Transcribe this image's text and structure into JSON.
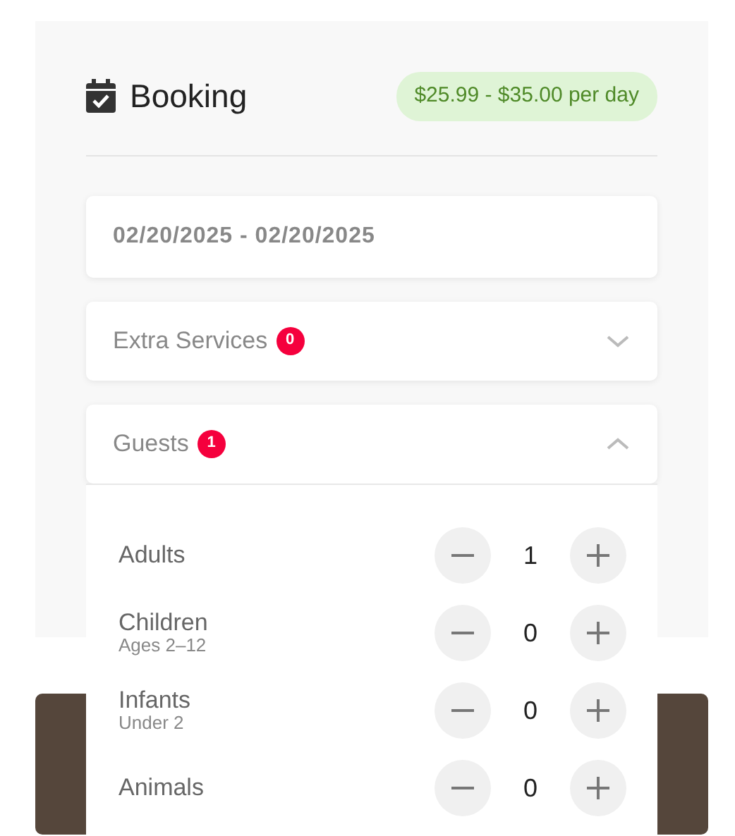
{
  "booking": {
    "title": "Booking",
    "price": "$25.99 - $35.00 per day",
    "date_range": {
      "value": "02/20/2025 - 02/20/2025"
    },
    "sections": [
      {
        "label": "Extra Services",
        "count": "0",
        "expanded": false
      },
      {
        "label": "Guests",
        "count": "1",
        "expanded": true,
        "items": [
          {
            "label": "Adults",
            "count": "1"
          },
          {
            "label": "Children",
            "sublabel": "Ages 2–12",
            "count": "0"
          },
          {
            "label": "Infants",
            "sublabel": "Under 2",
            "count": "0"
          },
          {
            "label": "Animals",
            "count": "0"
          }
        ]
      }
    ]
  }
}
